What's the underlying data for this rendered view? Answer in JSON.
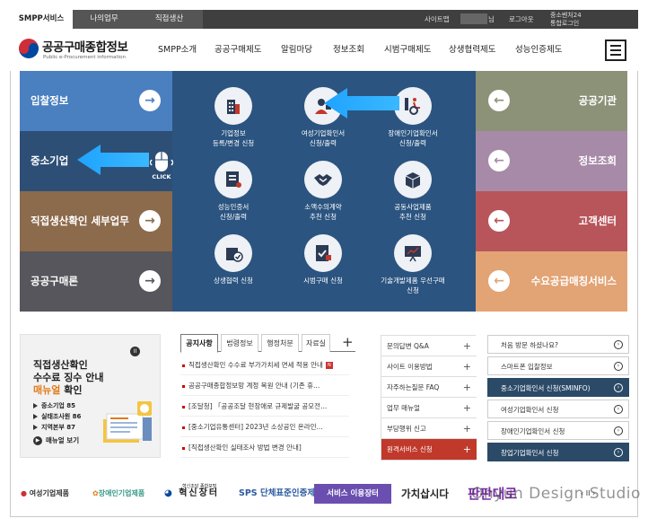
{
  "topbar": {
    "tabs": [
      "SMPP서비스",
      "나의업무",
      "직접생산"
    ],
    "util": {
      "sitemap": "사이트맵",
      "user": "님",
      "logout": "로그아웃",
      "venture_line1": "중소벤처24",
      "venture_line2": "통합로그인"
    }
  },
  "header": {
    "logo_name": "공공구매종합정보",
    "logo_sub": "Public e-Procurement information",
    "menu": [
      "SMPP소개",
      "공공구매제도",
      "알림마당",
      "정보조회",
      "시범구매제도",
      "상생협력제도",
      "성능인증제도"
    ]
  },
  "left_boxes": [
    "입찰정보",
    "중소기업",
    "직접생산확인 세부업무",
    "공공구매론"
  ],
  "right_boxes": [
    "공공기관",
    "정보조회",
    "고객센터",
    "수요공급매칭서비스"
  ],
  "mouse_label": "CLICK",
  "services": [
    {
      "line1": "기업정보",
      "line2": "등록/변경 신청",
      "icon": "building-icon"
    },
    {
      "line1": "여성기업확인서",
      "line2": "신청/출력",
      "icon": "woman-icon"
    },
    {
      "line1": "장애인기업확인서",
      "line2": "신청/출력",
      "icon": "wheelchair-icon"
    },
    {
      "line1": "성능인증서",
      "line2": "신청/출력",
      "icon": "scroll-icon"
    },
    {
      "line1": "소액수의계약",
      "line2": "추천 신청",
      "icon": "handshake-icon"
    },
    {
      "line1": "공동사업제품",
      "line2": "추천 신청",
      "icon": "box-icon"
    },
    {
      "line1": "상생협력 신청",
      "line2": "",
      "icon": "checked-box-icon"
    },
    {
      "line1": "시범구매 신청",
      "line2": "",
      "icon": "checklist-icon"
    },
    {
      "line1": "기술개발제품 우선구매",
      "line2": "신청",
      "icon": "presentation-icon"
    }
  ],
  "banner": {
    "title1": "직접생산확인",
    "title2": "수수료 징수 안내",
    "title3_hl": "매뉴얼",
    "title3_rest": " 확인",
    "bullets": [
      "중소기업 85",
      "실태조사원 86",
      "지역본부 87"
    ],
    "manual": "매뉴얼 보기",
    "pause": "II"
  },
  "notice": {
    "tabs": [
      "공지사항",
      "법령정보",
      "행정처분",
      "자료실"
    ],
    "plus": "+",
    "items": [
      "직접생산확인 수수료 부가가치세 면세 적용 안내",
      "공공구매종합정보망 계정 복원 안내 (기존 휴...",
      "[조달청] 「공공조달 현장애로 규제발굴 공모전...",
      "[중소기업유통센터] 2023년 소상공인 온라인...",
      "[직접생산확인 실태조사 방법 변경 안내]"
    ],
    "new_badge": "N"
  },
  "faq": {
    "items": [
      "문의답변 Q&A",
      "사이트 이용방법",
      "자주하는질문 FAQ",
      "업무 매뉴얼",
      "부당행위 신고",
      "원격서비스 신청"
    ],
    "plus": "+"
  },
  "quick": {
    "items": [
      "처음 방문 하셨나요?",
      "스마트폰 입찰정보",
      "중소기업확인서 신청(SMINFO)",
      "여성기업확인서 신청",
      "장애인기업확인서 신청",
      "창업기업확인서 신청"
    ],
    "go": "›"
  },
  "logos": {
    "items": [
      "여성기업제품",
      "장애인기업제품",
      "혁신장터",
      "SPS 단체표준인증제품",
      "서비스 이용장터",
      "가치삽시다",
      "판판대로"
    ],
    "innov_sub": "혁신조달 종합포털",
    "pager": "‹  II  ›"
  },
  "watermark": "Onyun Design Studio",
  "colors": {
    "box_blue": "#4a7fc0",
    "box_navy": "#2d4f76",
    "box_brown": "#8c6a4c",
    "box_gray": "#56565c",
    "center": "#2b5480",
    "box_olive": "#8c9278",
    "box_mauve": "#a78aa8",
    "box_red": "#b8555b",
    "box_orange": "#e2a375"
  }
}
